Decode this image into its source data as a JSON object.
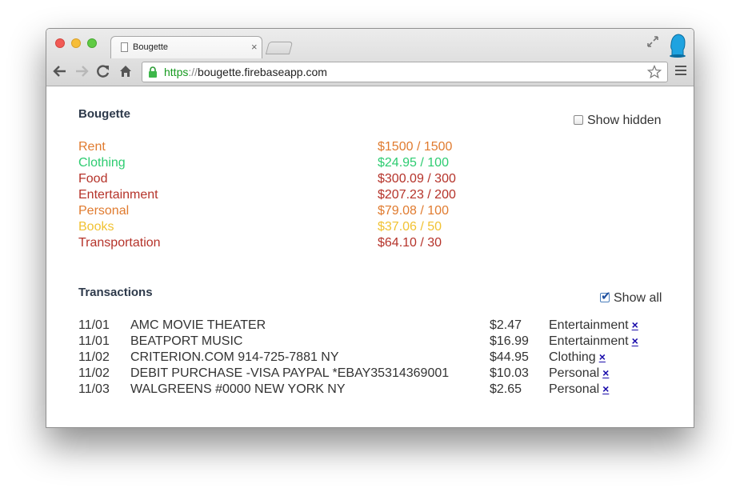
{
  "browser": {
    "tab_title": "Bougette",
    "tab_close": "×",
    "url_scheme": "https",
    "url_separator": "://",
    "url_host": "bougette.firebaseapp.com",
    "icons": [
      "close-dot",
      "minimize-dot",
      "zoom-dot",
      "document-icon",
      "fullscreen-icon",
      "profile-icon",
      "back-arrow-icon",
      "forward-arrow-icon",
      "reload-icon",
      "home-icon",
      "lock-icon",
      "star-icon",
      "hamburger-menu-icon"
    ]
  },
  "budgets": {
    "title": "Bougette",
    "show_hidden_label": "Show hidden",
    "show_hidden_checked": false,
    "items": [
      {
        "name": "Rent",
        "amount": "$1500 / 1500",
        "color": "#e07b2f"
      },
      {
        "name": "Clothing",
        "amount": "$24.95 / 100",
        "color": "#2ecc71"
      },
      {
        "name": "Food",
        "amount": "$300.09 / 300",
        "color": "#b5332a"
      },
      {
        "name": "Entertainment",
        "amount": "$207.23 / 200",
        "color": "#b5332a"
      },
      {
        "name": "Personal",
        "amount": "$79.08 / 100",
        "color": "#e07b2f"
      },
      {
        "name": "Books",
        "amount": "$37.06 / 50",
        "color": "#f1c232"
      },
      {
        "name": "Transportation",
        "amount": "$64.10 / 30",
        "color": "#b5332a"
      }
    ]
  },
  "transactions": {
    "title": "Transactions",
    "show_all_label": "Show all",
    "show_all_checked": true,
    "delete_label": "×",
    "rows": [
      {
        "date": "11/01",
        "description": "AMC MOVIE THEATER",
        "amount": "$2.47",
        "category": "Entertainment"
      },
      {
        "date": "11/01",
        "description": "BEATPORT MUSIC",
        "amount": "$16.99",
        "category": "Entertainment"
      },
      {
        "date": "11/02",
        "description": "CRITERION.COM 914-725-7881 NY",
        "amount": "$44.95",
        "category": "Clothing"
      },
      {
        "date": "11/02",
        "description": "DEBIT PURCHASE -VISA PAYPAL *EBAY35314369001",
        "amount": "$10.03",
        "category": "Personal"
      },
      {
        "date": "11/03",
        "description": "WALGREENS #0000 NEW YORK NY",
        "amount": "$2.65",
        "category": "Personal"
      }
    ]
  }
}
